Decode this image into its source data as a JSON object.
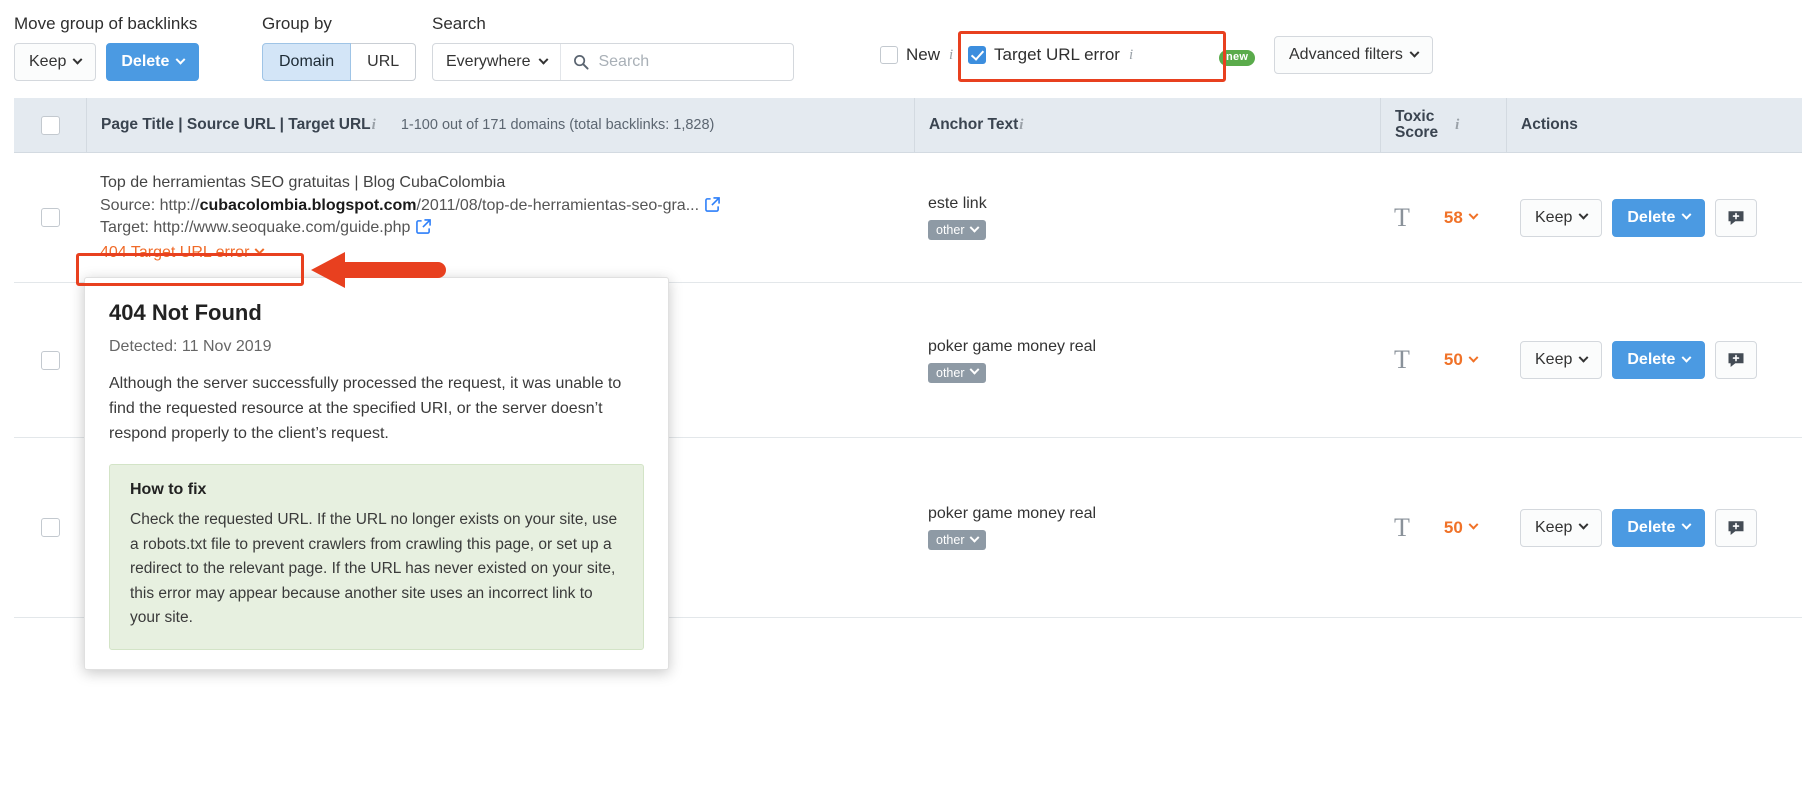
{
  "toolbar": {
    "move_group_label": "Move group of backlinks",
    "keep_button": "Keep",
    "delete_button": "Delete",
    "group_by_label": "Group by",
    "group_domain": "Domain",
    "group_url": "URL",
    "search_label": "Search",
    "search_scope": "Everywhere",
    "search_placeholder": "Search",
    "search_value": "",
    "new_filter": "New",
    "target_url_error_filter": "Target URL error",
    "new_badge": "new",
    "advanced_filters": "Advanced filters"
  },
  "table": {
    "headers": {
      "title": "Page Title | Source URL | Target URL",
      "count": "1-100 out of 171 domains (total backlinks: 1,828)",
      "anchor": "Anchor Text",
      "toxic_line1": "Toxic",
      "toxic_line2": "Score",
      "actions": "Actions"
    },
    "rows": [
      {
        "page_title": "Top de herramientas SEO gratuitas | Blog CubaColombia",
        "source_prefix": "Source: http://",
        "source_domain": "cubacolombia.blogspot.com",
        "source_path": "/2011/08/top-de-herramientas-seo-gra...",
        "target_line": "Target: http://www.seoquake.com/guide.php",
        "error_link": "404 Target URL error",
        "anchor": "este link",
        "anchor_tag": "other",
        "toxic_score": "58",
        "keep": "Keep",
        "delete": "Delete"
      },
      {
        "page_title": "",
        "source_prefix": "",
        "source_domain": "",
        "source_path": "",
        "target_line": "",
        "error_link": "",
        "anchor": "poker game money real",
        "anchor_tag": "other",
        "toxic_score": "50",
        "keep": "Keep",
        "delete": "Delete"
      },
      {
        "page_title": "",
        "source_prefix": "",
        "source_domain": "",
        "source_path": "",
        "target_line": "",
        "error_link": "",
        "anchor": "poker game money real",
        "anchor_tag": "other",
        "toxic_score": "50",
        "keep": "Keep",
        "delete": "Delete"
      }
    ]
  },
  "popup": {
    "title": "404 Not Found",
    "detected": "Detected: 11 Nov 2019",
    "description": "Although the server successfully processed the request, it was unable to find the requested resource at the specified URI, or the server doesn’t respond properly to the client’s request.",
    "howto_title": "How to fix",
    "howto_text": "Check the requested URL. If the URL no longer exists on your site, use a robots.txt file to prevent crawlers from crawling this page, or set up a redirect to the relevant page. If the URL has never existed on your site, this error may appear because another site uses an incorrect link to your site."
  },
  "colors": {
    "accent_blue": "#4b9ae2",
    "highlight_red": "#e8401f",
    "error_orange": "#f06a28",
    "badge_green": "#5aab4b",
    "header_bg": "#e4eaf0",
    "howto_bg": "#e7f0e0"
  }
}
